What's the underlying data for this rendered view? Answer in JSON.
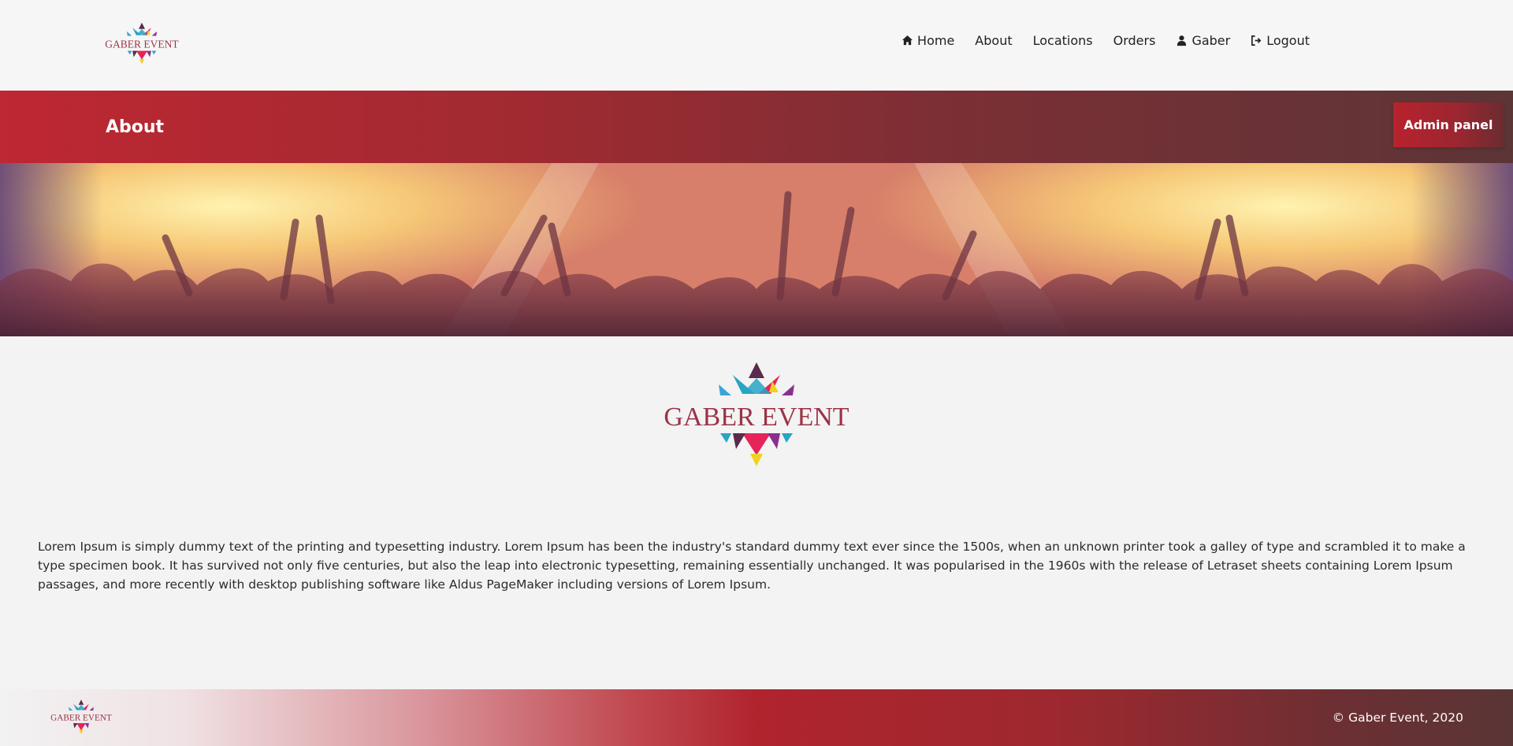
{
  "brand": {
    "name": "GABER EVENT",
    "logo_colors": [
      "#e6245a",
      "#27a5c4",
      "#8b2f8e",
      "#f2d01f",
      "#5a2b4a",
      "#3aa4d8"
    ]
  },
  "nav": {
    "items": [
      {
        "label": "Home",
        "icon": "home-icon"
      },
      {
        "label": "About",
        "icon": ""
      },
      {
        "label": "Locations",
        "icon": ""
      },
      {
        "label": "Orders",
        "icon": ""
      },
      {
        "label": "Gaber",
        "icon": "user-icon"
      },
      {
        "label": "Logout",
        "icon": "sign-out-icon"
      }
    ]
  },
  "banner": {
    "title": "About",
    "admin_label": "Admin panel"
  },
  "content": {
    "body": "Lorem Ipsum is simply dummy text of the printing and typesetting industry. Lorem Ipsum has been the industry's standard dummy text ever since the 1500s, when an unknown printer took a galley of type and scrambled it to make a type specimen book. It has survived not only five centuries, but also the leap into electronic typesetting, remaining essentially unchanged. It was popularised in the 1960s with the release of Letraset sheets containing Lorem Ipsum passages, and more recently with desktop publishing software like Aldus PageMaker including versions of Lorem Ipsum."
  },
  "footer": {
    "copyright": "© Gaber Event, 2020"
  },
  "colors": {
    "brand_red": "#be2733",
    "brand_dark": "#5c3536",
    "background": "#f3f3f3"
  }
}
